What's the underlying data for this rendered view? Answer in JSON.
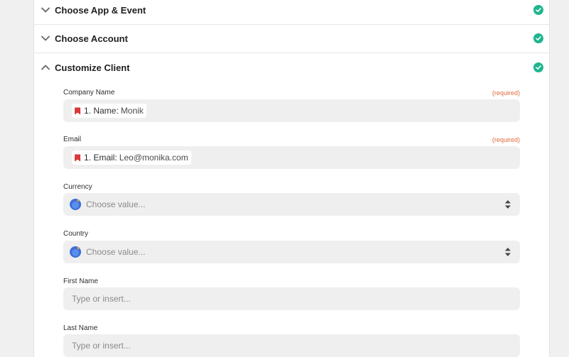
{
  "sections": [
    {
      "title": "Choose App & Event",
      "state": "collapsed",
      "complete": true
    },
    {
      "title": "Choose Account",
      "state": "collapsed",
      "complete": true
    },
    {
      "title": "Customize Client",
      "state": "expanded",
      "complete": true
    }
  ],
  "fields": {
    "company_name": {
      "label": "Company Name",
      "required": "(required)",
      "pill_key": "1. Name:",
      "pill_value": "Monik"
    },
    "email": {
      "label": "Email",
      "required": "(required)",
      "pill_key": "1. Email:",
      "pill_value": "Leo@monika.com"
    },
    "currency": {
      "label": "Currency",
      "placeholder": "Choose value..."
    },
    "country": {
      "label": "Country",
      "placeholder": "Choose value..."
    },
    "first_name": {
      "label": "First Name",
      "placeholder": "Type or insert..."
    },
    "last_name": {
      "label": "Last Name",
      "placeholder": "Type or insert..."
    }
  },
  "icons": {
    "collapsed_chevron": "chevron-down-icon",
    "expanded_chevron": "chevron-up-icon",
    "complete": "check-circle-icon",
    "step": "step-bookmark-icon",
    "app": "app-logo-icon",
    "select": "updown-arrows-icon"
  },
  "colors": {
    "check": "#1fb58f",
    "required": "#e06a3a",
    "step_icon": "#d93a3a",
    "app_icon": "#3d6fd8",
    "field_bg": "#efefef"
  }
}
